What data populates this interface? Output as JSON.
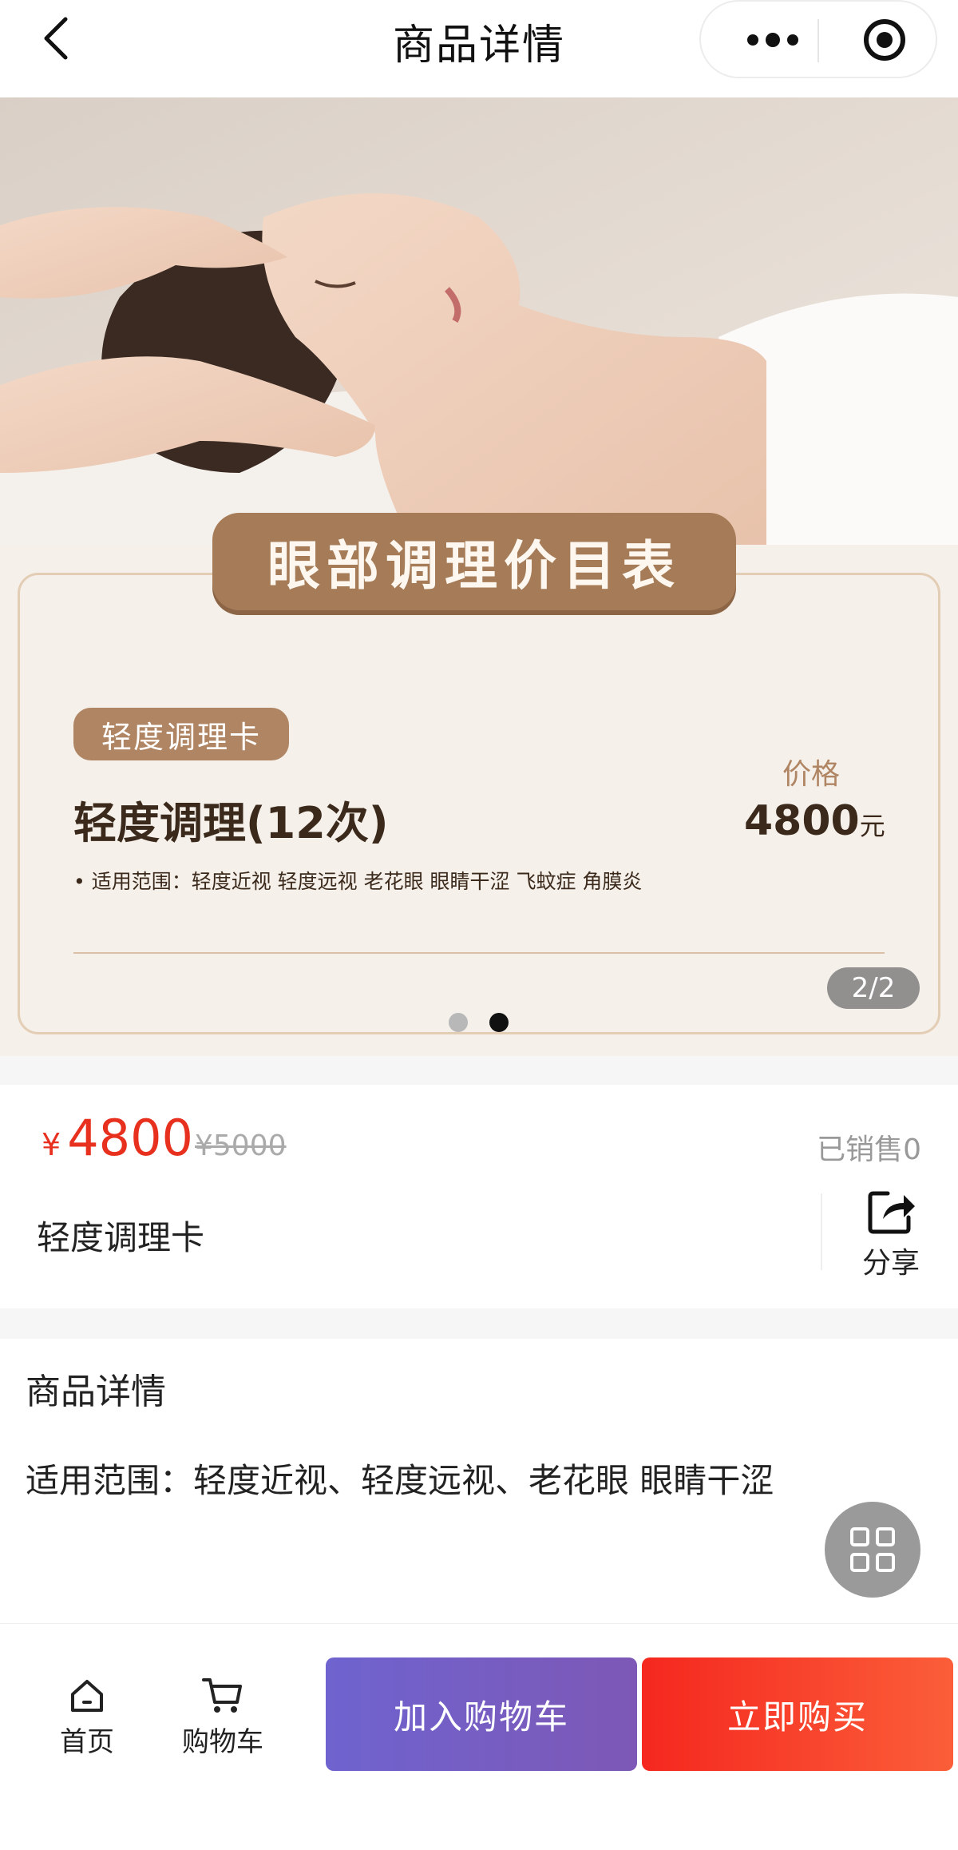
{
  "nav": {
    "title": "商品详情"
  },
  "banner": {
    "image": "woman-receiving-eye-massage-photo",
    "card_title": "眼部调理价目表",
    "tag": "轻度调理卡",
    "name": "轻度调理(12次)",
    "scope": "• 适用范围：轻度近视  轻度远视  老花眼  眼睛干涩  飞蚊症  角膜炎",
    "price_label": "价格",
    "price_value": "4800",
    "price_unit": "元",
    "counter": "2/2",
    "active_slide": 2,
    "slide_count": 2
  },
  "price": {
    "currency": "¥",
    "current": "4800",
    "original": "¥5000",
    "sold": "已销售0"
  },
  "product": {
    "name": "轻度调理卡",
    "share_label": "分享"
  },
  "details": {
    "title": "商品详情",
    "text": "适用范围：轻度近视、轻度远视、老花眼 眼睛干涩"
  },
  "bottom": {
    "home_label": "首页",
    "cart_label": "购物车",
    "add_to_cart": "加入购物车",
    "buy_now": "立即购买"
  },
  "colors": {
    "price_red": "#e8301e",
    "add_cart_gradient": [
      "#6f63cf",
      "#7d58b6"
    ],
    "buy_gradient": [
      "#f5271f",
      "#fb5e39"
    ],
    "card_accent": "#a67c58"
  }
}
